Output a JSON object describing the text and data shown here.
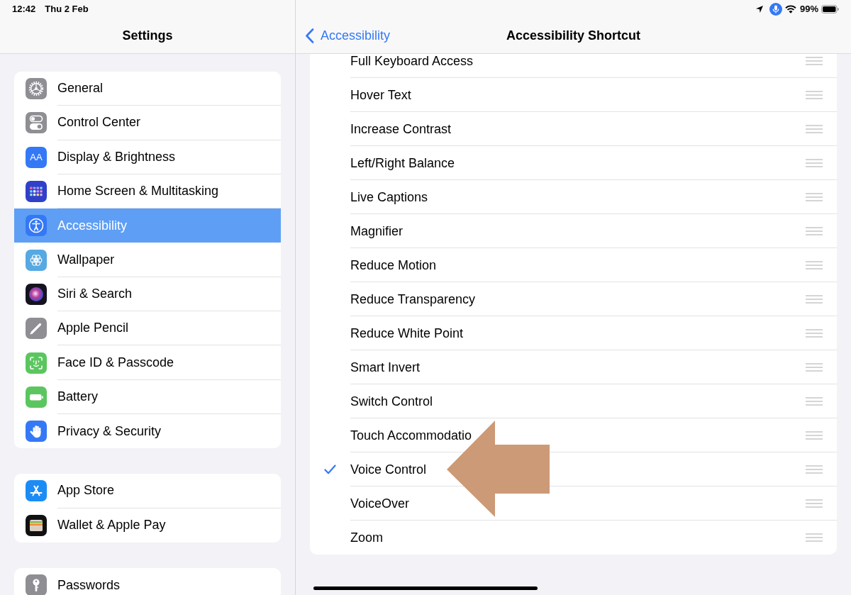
{
  "status_bar": {
    "time": "12:42",
    "date": "Thu 2 Feb",
    "battery": "99%"
  },
  "sidebar": {
    "title": "Settings",
    "groups": [
      {
        "items": [
          {
            "label": "General",
            "selected": false
          },
          {
            "label": "Control Center",
            "selected": false
          },
          {
            "label": "Display & Brightness",
            "selected": false,
            "icon_text": "AA"
          },
          {
            "label": "Home Screen & Multitasking",
            "selected": false
          },
          {
            "label": "Accessibility",
            "selected": true
          },
          {
            "label": "Wallpaper",
            "selected": false
          },
          {
            "label": "Siri & Search",
            "selected": false
          },
          {
            "label": "Apple Pencil",
            "selected": false
          },
          {
            "label": "Face ID & Passcode",
            "selected": false
          },
          {
            "label": "Battery",
            "selected": false
          },
          {
            "label": "Privacy & Security",
            "selected": false
          }
        ]
      },
      {
        "items": [
          {
            "label": "App Store",
            "selected": false
          },
          {
            "label": "Wallet & Apple Pay",
            "selected": false
          }
        ]
      },
      {
        "items": [
          {
            "label": "Passwords",
            "selected": false
          }
        ]
      }
    ]
  },
  "detail": {
    "back": "Accessibility",
    "title": "Accessibility Shortcut",
    "options": [
      {
        "label": "Full Keyboard Access",
        "checked": false
      },
      {
        "label": "Hover Text",
        "checked": false
      },
      {
        "label": "Increase Contrast",
        "checked": false
      },
      {
        "label": "Left/Right Balance",
        "checked": false
      },
      {
        "label": "Live Captions",
        "checked": false
      },
      {
        "label": "Magnifier",
        "checked": false
      },
      {
        "label": "Reduce Motion",
        "checked": false
      },
      {
        "label": "Reduce Transparency",
        "checked": false
      },
      {
        "label": "Reduce White Point",
        "checked": false
      },
      {
        "label": "Smart Invert",
        "checked": false
      },
      {
        "label": "Switch Control",
        "checked": false
      },
      {
        "label": "Touch Accommodatio",
        "checked": false
      },
      {
        "label": "Voice Control",
        "checked": true
      },
      {
        "label": "VoiceOver",
        "checked": false
      },
      {
        "label": "Zoom",
        "checked": false
      }
    ]
  }
}
